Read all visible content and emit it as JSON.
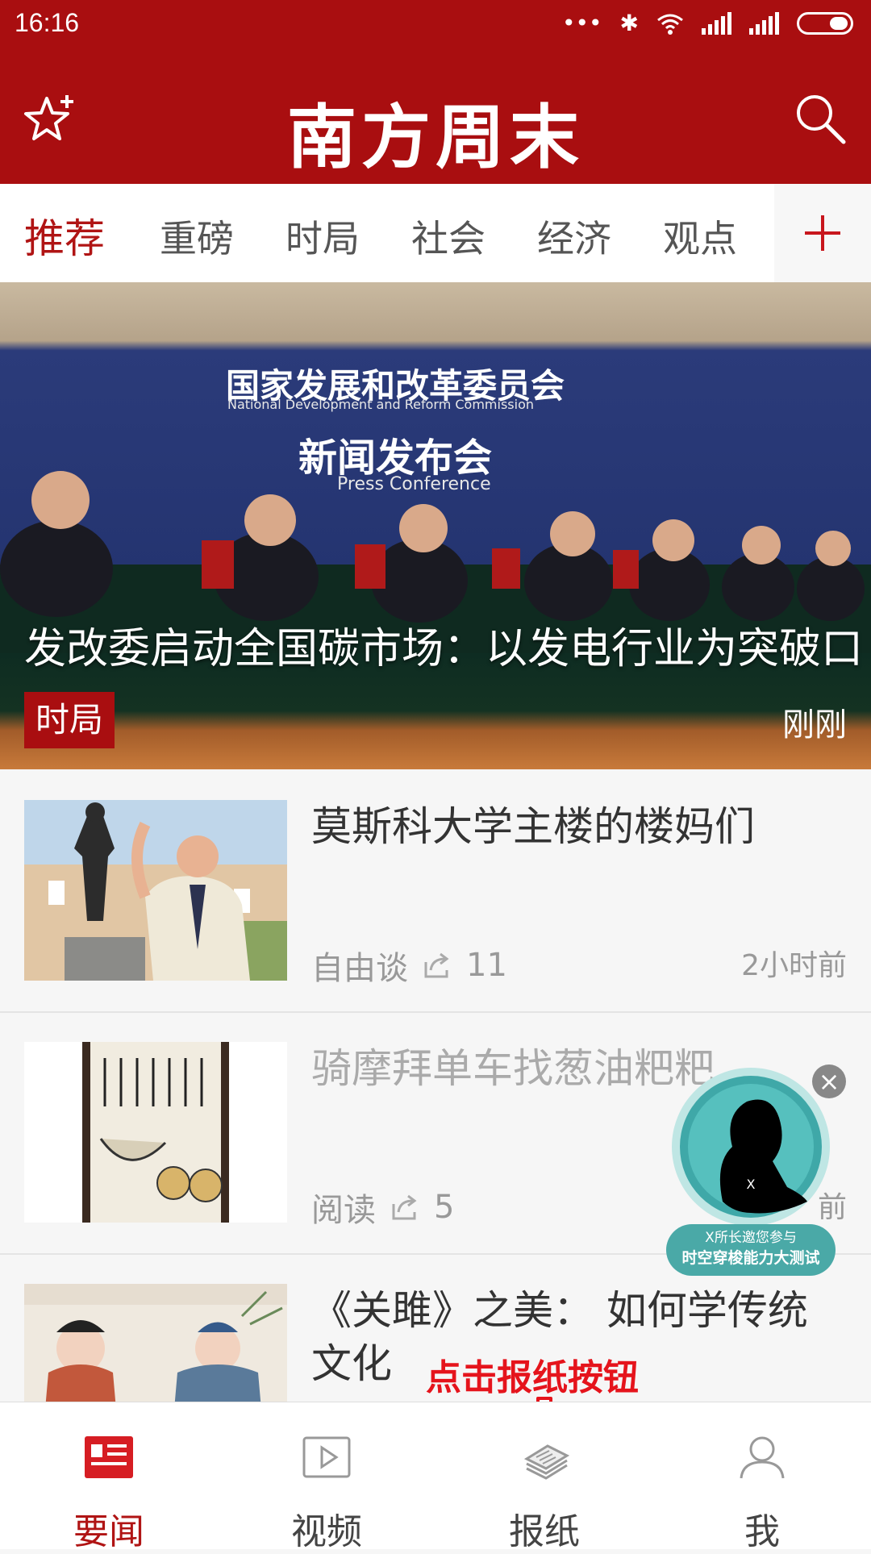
{
  "status_bar": {
    "time": "16:16"
  },
  "app": {
    "logo_text": "南方周末"
  },
  "tabs": [
    {
      "label": "推荐",
      "active": true
    },
    {
      "label": "重磅"
    },
    {
      "label": "时局"
    },
    {
      "label": "社会"
    },
    {
      "label": "经济"
    },
    {
      "label": "观点"
    }
  ],
  "hero": {
    "banner_cn": "国家发展和改革委员会",
    "banner_en": "National Development and Reform Commission",
    "banner_cn2": "新闻发布会",
    "banner_en2": "Press Conference",
    "headline": "发改委启动全国碳市场：以发电行业为突破口",
    "category": "时局",
    "time": "刚刚"
  },
  "articles": [
    {
      "title": "莫斯科大学主楼的楼妈们",
      "source": "自由谈",
      "shares": "11",
      "time": "2小时前"
    },
    {
      "title": "骑摩拜单车找葱油粑粑",
      "source": "阅读",
      "shares": "5",
      "time": "前"
    },
    {
      "title": "《关雎》之美： 如何学传统文化",
      "source": "",
      "shares": "",
      "time": ""
    }
  ],
  "float_ad": {
    "line1": "X所长邀您参与",
    "line2": "时空穿梭能力大测试",
    "mark": "X",
    "close": "×"
  },
  "hint": {
    "text": "点击报纸按钮"
  },
  "bottom_nav": [
    {
      "label": "要闻",
      "active": true
    },
    {
      "label": "视频"
    },
    {
      "label": "报纸"
    },
    {
      "label": "我"
    }
  ],
  "colors": {
    "brand": "#a90e10",
    "accent": "#b01414",
    "hint": "#e5141c"
  }
}
